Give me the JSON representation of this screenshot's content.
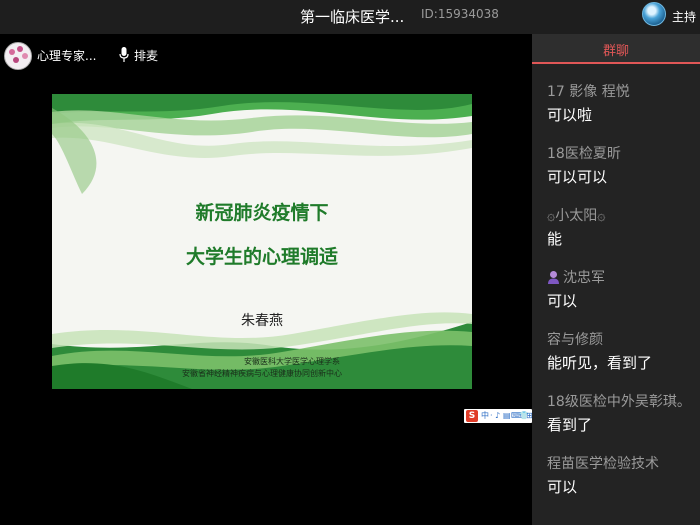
{
  "header": {
    "room_title": "第一临床医学...",
    "room_id": "ID:15934038",
    "host_label": "主持"
  },
  "stream": {
    "owner_name": "心理专家...",
    "mic_label": "排麦"
  },
  "slide": {
    "title_line1": "新冠肺炎疫情下",
    "title_line2": "大学生的心理调适",
    "presenter": "朱春燕",
    "affiliation_line1": "安徽医科大学医学心理学系",
    "affiliation_line2": "安徽省神经精神疾病与心理健康协同创新中心"
  },
  "ime_toolbar": {
    "logo": "S",
    "glyphs": [
      "中",
      "·",
      "♪",
      "▤",
      "⌨",
      "👕",
      "⊞"
    ]
  },
  "sidebar": {
    "tab_label": "群聊",
    "accent_color": "#e05757",
    "messages": [
      {
        "sender": "17 影像 程悦",
        "text": "可以啦"
      },
      {
        "sender": "18医检夏昕",
        "text": "可以可以"
      },
      {
        "sender": "۞小太阳۞",
        "text": "能"
      },
      {
        "sender": "沈忠军",
        "text": "可以"
      },
      {
        "sender": "容与修颜",
        "text": "能听见，看到了"
      },
      {
        "sender": "18级医检中外吴彰琪。",
        "text": "看到了"
      },
      {
        "sender": "程苗医学检验技术",
        "text": "可以"
      }
    ]
  }
}
